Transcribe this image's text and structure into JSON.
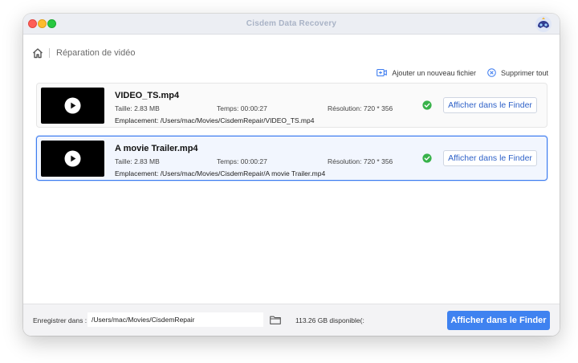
{
  "window": {
    "title": "Cisdem Data Recovery"
  },
  "breadcrumb": {
    "label": "Réparation de vidéo"
  },
  "actions": {
    "add_file": "Ajouter un nouveau fichier",
    "remove_all": "Supprimer tout"
  },
  "files": [
    {
      "name": "VIDEO_TS.mp4",
      "size": "Taille: 2.83 MB",
      "duration": "Temps: 00:00:27",
      "resolution": "Résolution: 720 * 356",
      "path": "Emplacement: /Users/mac/Movies/CisdemRepair/VIDEO_TS.mp4",
      "button": "Afficher dans le Finder",
      "status": "success",
      "selected": false
    },
    {
      "name": "A movie Trailer.mp4",
      "size": "Taille: 2.83 MB",
      "duration": "Temps: 00:00:27",
      "resolution": "Résolution: 720 * 356",
      "path": "Emplacement: /Users/mac/Movies/CisdemRepair/A movie Trailer.mp4",
      "button": "Afficher dans le Finder",
      "status": "success",
      "selected": true
    }
  ],
  "footer": {
    "save_label": "Enregistrer dans :",
    "save_path": "/Users/mac/Movies/CisdemRepair",
    "disk_space": "113.26 GB disponible(:",
    "primary_button": "Afficher dans le Finder"
  },
  "colors": {
    "accent": "#3f82f0",
    "success": "#38b24a",
    "selected_border": "#3d7cf0"
  },
  "icons": {
    "home": "home-icon",
    "add_file": "add-video-icon",
    "remove_all": "close-circle-icon",
    "play": "play-icon",
    "status": "check-circle-icon",
    "folder": "folder-icon"
  }
}
